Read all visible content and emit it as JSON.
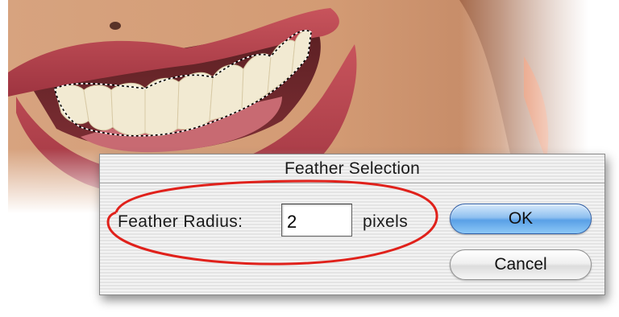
{
  "dialog": {
    "title": "Feather Selection",
    "feather_radius_label": "Feather Radius:",
    "feather_radius_value": "2",
    "unit_label": "pixels",
    "ok_label": "OK",
    "cancel_label": "Cancel"
  },
  "colors": {
    "highlight": "#e0211b",
    "ok_button": "#5aa0e6",
    "skin": "#d9a07c",
    "lips": "#b8404a"
  }
}
